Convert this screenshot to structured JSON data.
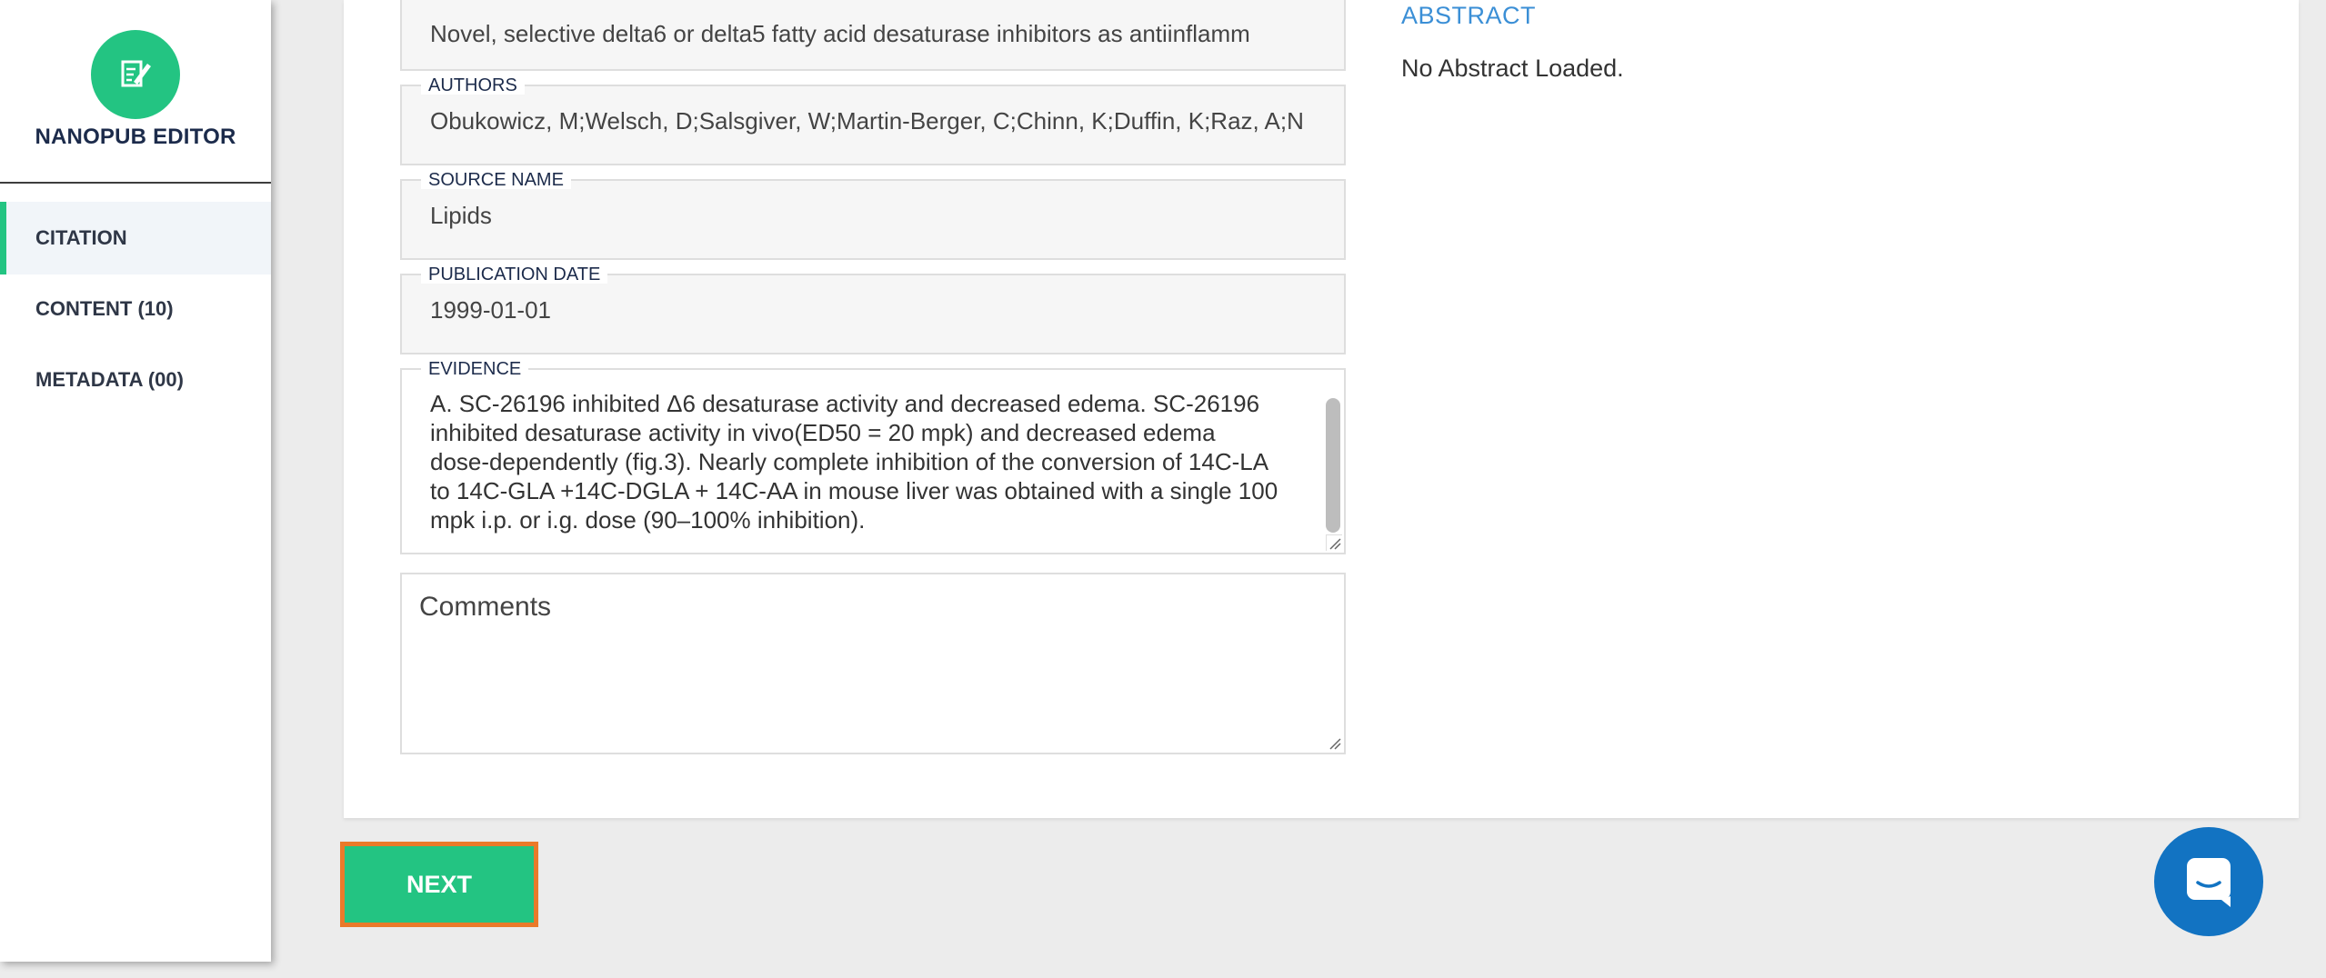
{
  "app": {
    "title": "NANOPUB EDITOR",
    "logo_icon": "edit-document-icon",
    "accent_color": "#23c482"
  },
  "sidebar": {
    "items": [
      {
        "label": "CITATION",
        "active": true
      },
      {
        "label": "CONTENT (10)",
        "active": false
      },
      {
        "label": "METADATA (00)",
        "active": false
      }
    ]
  },
  "citation": {
    "title_value": "Novel, selective delta6 or delta5 fatty acid desaturase inhibitors as antiinflamm",
    "authors": {
      "label": "AUTHORS",
      "value": "Obukowicz, M;Welsch, D;Salsgiver, W;Martin-Berger, C;Chinn, K;Duffin, K;Raz, A;N"
    },
    "source_name": {
      "label": "SOURCE NAME",
      "value": "Lipids"
    },
    "publication_date": {
      "label": "PUBLICATION DATE",
      "value": "1999-01-01"
    },
    "evidence": {
      "label": "EVIDENCE",
      "value": "A. SC-26196 inhibited Δ6 desaturase activity and decreased edema.  SC-26196 inhibited desaturase activity in vivo(ED50 = 20 mpk) and decreased edema dose-dependently (fig.3). Nearly complete inhibition of the conversion of 14C-LA to 14C-GLA +14C-DGLA + 14C-AA in mouse liver was obtained with a single 100 mpk i.p. or i.g. dose (90–100% inhibition)."
    },
    "comments": {
      "placeholder": "Comments"
    }
  },
  "abstract": {
    "heading": "ABSTRACT",
    "body": "No Abstract Loaded."
  },
  "actions": {
    "next_label": "NEXT"
  },
  "chat": {
    "icon": "chat-bubble-icon",
    "color": "#1273c2"
  }
}
